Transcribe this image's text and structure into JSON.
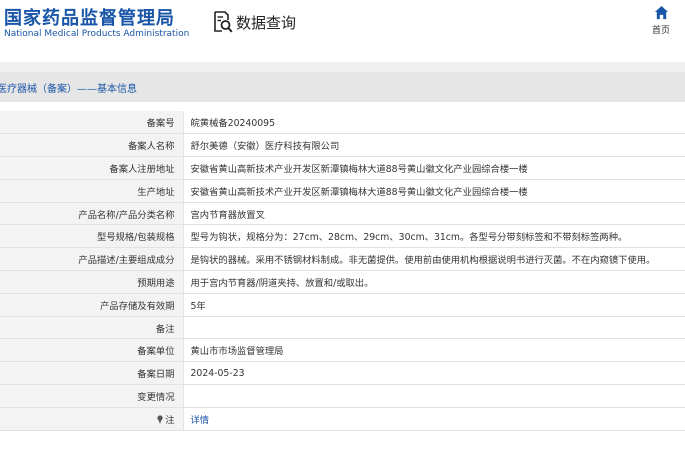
{
  "header": {
    "logo_cn": "国家药品监督管理局",
    "logo_en": "National Medical Products Administration",
    "query_label": "数据查询",
    "home_label": "首页"
  },
  "section": {
    "title": "医疗器械（备案）——基本信息"
  },
  "rows": [
    {
      "label": "备案号",
      "value": "皖黄械备20240095"
    },
    {
      "label": "备案人名称",
      "value": "舒尔美德（安徽）医疗科技有限公司"
    },
    {
      "label": "备案人注册地址",
      "value": "安徽省黄山高新技术产业开发区新潭镇梅林大道88号黄山徽文化产业园综合楼一楼"
    },
    {
      "label": "生产地址",
      "value": "安徽省黄山高新技术产业开发区新潭镇梅林大道88号黄山徽文化产业园综合楼一楼"
    },
    {
      "label": "产品名称/产品分类名称",
      "value": "宫内节育器放置叉"
    },
    {
      "label": "型号规格/包装规格",
      "value": "型号为钩状，规格分为：27cm、28cm、29cm、30cm、31cm。各型号分带刻标签和不带刻标签两种。"
    },
    {
      "label": "产品描述/主要组成成分",
      "value": "是钩状的器械。采用不锈钢材料制成。非无菌提供。使用前由使用机构根据说明书进行灭菌。不在内窥镜下使用。"
    },
    {
      "label": "预期用途",
      "value": "用于宫内节育器/阴道夹持、放置和/或取出。"
    },
    {
      "label": "产品存储及有效期",
      "value": "5年"
    },
    {
      "label": "备注",
      "value": ""
    },
    {
      "label": "备案单位",
      "value": "黄山市市场监督管理局"
    },
    {
      "label": "备案日期",
      "value": "2024-05-23"
    },
    {
      "label": "变更情况",
      "value": ""
    },
    {
      "label": "注",
      "value": "详情"
    }
  ],
  "icons": {
    "query": "magnifier-document-icon",
    "home": "home-icon",
    "note": "pin-icon"
  },
  "colors": {
    "brand_blue": "#1a56a8",
    "label_bg": "#f3f3f3",
    "section_bg": "#e6e6e6"
  }
}
